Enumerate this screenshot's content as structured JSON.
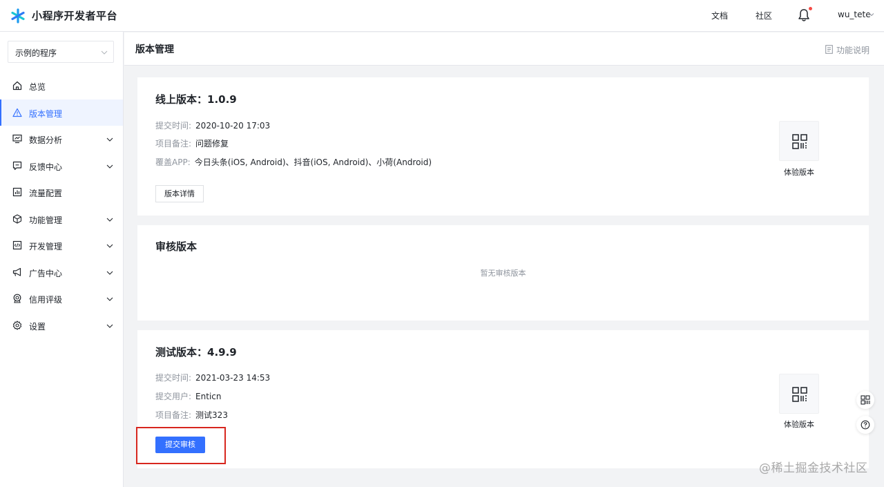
{
  "brand": {
    "title": "小程序开发者平台",
    "logo_icon": "asterisk-logo"
  },
  "topbar": {
    "links": [
      "文档",
      "社区"
    ],
    "notification_icon": "bell-icon",
    "user": "wu_tete"
  },
  "sidebar": {
    "app_select": "示例的程序",
    "items": [
      {
        "label": "总览",
        "icon": "home-icon",
        "expandable": false,
        "active": false
      },
      {
        "label": "版本管理",
        "icon": "warning-triangle-icon",
        "expandable": false,
        "active": true
      },
      {
        "label": "数据分析",
        "icon": "monitor-chart-icon",
        "expandable": true,
        "active": false
      },
      {
        "label": "反馈中心",
        "icon": "feedback-icon",
        "expandable": true,
        "active": false
      },
      {
        "label": "流量配置",
        "icon": "bar-chart-icon",
        "expandable": false,
        "active": false
      },
      {
        "label": "功能管理",
        "icon": "cube-icon",
        "expandable": true,
        "active": false
      },
      {
        "label": "开发管理",
        "icon": "code-icon",
        "expandable": true,
        "active": false
      },
      {
        "label": "广告中心",
        "icon": "megaphone-icon",
        "expandable": true,
        "active": false
      },
      {
        "label": "信用评级",
        "icon": "badge-icon",
        "expandable": true,
        "active": false
      },
      {
        "label": "设置",
        "icon": "gear-icon",
        "expandable": true,
        "active": false
      }
    ]
  },
  "page": {
    "title": "版本管理",
    "help_link": "功能说明"
  },
  "online_version": {
    "title": "线上版本：1.0.9",
    "rows": [
      {
        "key": "提交时间:",
        "value": "2020-10-20 17:03"
      },
      {
        "key": "项目备注:",
        "value": "问题修复"
      },
      {
        "key": "覆盖APP:",
        "value": "今日头条(iOS, Android)、抖音(iOS, Android)、小荷(Android)"
      }
    ],
    "button": "版本详情",
    "qr_label": "体验版本"
  },
  "review_version": {
    "title": "审核版本",
    "empty_text": "暂无审核版本"
  },
  "test_version": {
    "title": "测试版本：4.9.9",
    "rows": [
      {
        "key": "提交时间:",
        "value": "2021-03-23 14:53"
      },
      {
        "key": "提交用户:",
        "value": "Enticn"
      },
      {
        "key": "项目备注:",
        "value": "测试323"
      }
    ],
    "button": "提交审核",
    "qr_label": "体验版本"
  },
  "watermark": "@稀土掘金技术社区",
  "colors": {
    "accent": "#3370ff",
    "highlight": "#d7261e",
    "notification": "#f54a45"
  }
}
